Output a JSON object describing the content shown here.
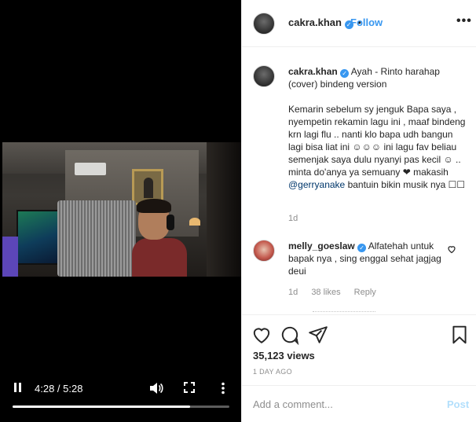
{
  "video": {
    "current_time": "4:28",
    "separator": " / ",
    "duration": "5:28",
    "progress_fraction": 0.818
  },
  "header": {
    "username": "cakra.khan",
    "follow_label": "Follow",
    "bullet": "•"
  },
  "caption": {
    "username": "cakra.khan",
    "text_part1": "Ayah - Rinto harahap (cover) bindeng version",
    "text_part2": "Kemarin sebelum sy jenguk Bapa saya , nyempetin rekamin lagu ini , maaf bindeng krn lagi flu .. nanti klo bapa udh bangun lagi bisa liat ini ☺☺☺ ini lagu fav beliau semenjak saya dulu nyanyi pas kecil ☺ .. minta do'anya ya semuany ❤ makasih",
    "mention": "@gerryanake",
    "text_part3": "bantuin bikin musik nya ☐☐",
    "time": "1d"
  },
  "comment": {
    "username": "melly_goeslaw",
    "text": "Alfatehah untuk bapak nya , sing enggal sehat jagjag deui",
    "time": "1d",
    "likes": "38 likes",
    "reply": "Reply"
  },
  "stats": {
    "views": "35,123 views",
    "posted": "1 DAY AGO"
  },
  "add_comment": {
    "placeholder": "Add a comment...",
    "post_label": "Post"
  },
  "colors": {
    "accent": "#3897f0",
    "mention": "#00376b",
    "muted": "#8e8e8e"
  }
}
